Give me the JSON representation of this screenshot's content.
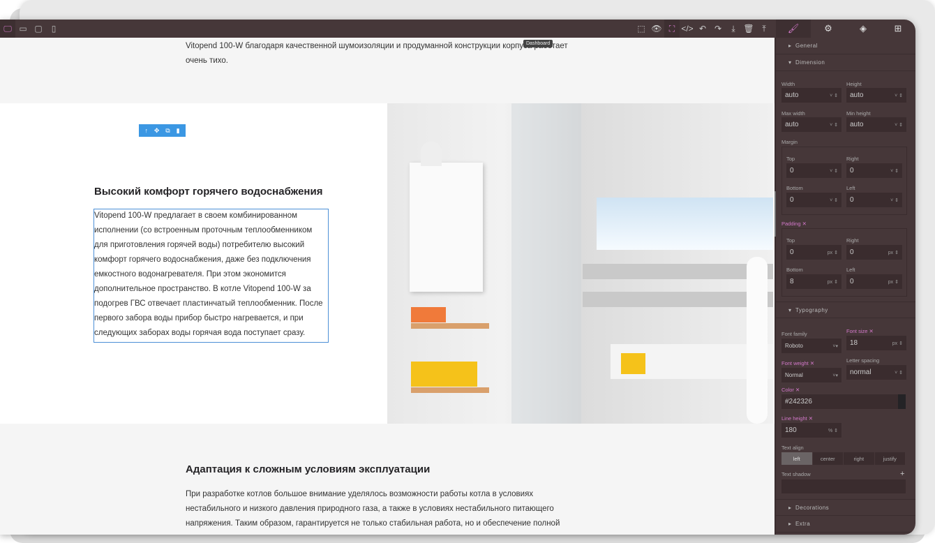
{
  "devices": [
    "desktop",
    "laptop",
    "tablet",
    "mobile"
  ],
  "tooltip": "Dashboard",
  "content": {
    "intro_lines": [
      "Vitopend 100-W благодаря качественной шумоизоляции и продуманной конструкции корпуса работает",
      "очень тихо."
    ],
    "section_title": "Высокий комфорт горячего водоснабжения",
    "section_lines": [
      "Vitopend 100-W предлагает в своем комбинированном",
      "исполнении (со встроенным проточным теплообменником",
      "для приготовления горячей воды) потребителю высокий",
      "комфорт горячего водоснабжения, даже без подключения",
      "емкостного водонагревателя. При этом экономится",
      "дополнительное пространство. В котле Vitopend 100-W за",
      "подогрев ГВС отвечает пластинчатый теплообменник. После",
      "первого забора воды прибор быстро нагревается, и при",
      "следующих заборах воды горячая вода поступает сразу."
    ],
    "section2_title": "Адаптация к сложным условиям эксплуатации",
    "section2_lines": [
      "При разработке котлов большое внимание уделялось возможности работы котла в условиях",
      "нестабильного и низкого давления природного газа, а также в условиях нестабильного питающего",
      "напряжения. Таким образом, гарантируется не только стабильная работа, но и обеспечение полной"
    ]
  },
  "panel": {
    "general": "General",
    "dimension": "Dimension",
    "typography": "Typography",
    "decorations": "Decorations",
    "extra": "Extra",
    "width_label": "Width",
    "width": "auto",
    "height_label": "Height",
    "height": "auto",
    "maxw_label": "Max width",
    "maxw": "auto",
    "minh_label": "Min height",
    "minh": "auto",
    "margin_label": "Margin",
    "padding_label": "Padding ✕",
    "top": "Top",
    "right": "Right",
    "bottom": "Bottom",
    "left": "Left",
    "margin": {
      "top": "0",
      "right": "0",
      "bottom": "0",
      "left": "0"
    },
    "padding": {
      "top": "0",
      "right": "0",
      "bottom": "8",
      "left": "0"
    },
    "px": "px",
    "pct": "%",
    "font_family_label": "Font family",
    "font_family": "Roboto",
    "font_size_label": "Font size ✕",
    "font_size": "18",
    "font_weight_label": "Font weight ✕",
    "font_weight": "Normal",
    "letter_spacing_label": "Letter spacing",
    "letter_spacing": "normal",
    "color_label": "Color ✕",
    "color": "#242326",
    "line_height_label": "Line height ✕",
    "line_height": "180",
    "text_align_label": "Text align",
    "align": [
      "left",
      "center",
      "right",
      "justify"
    ],
    "text_shadow_label": "Text shadow"
  },
  "accent": "#d278c9",
  "selection": "#3b97e3"
}
